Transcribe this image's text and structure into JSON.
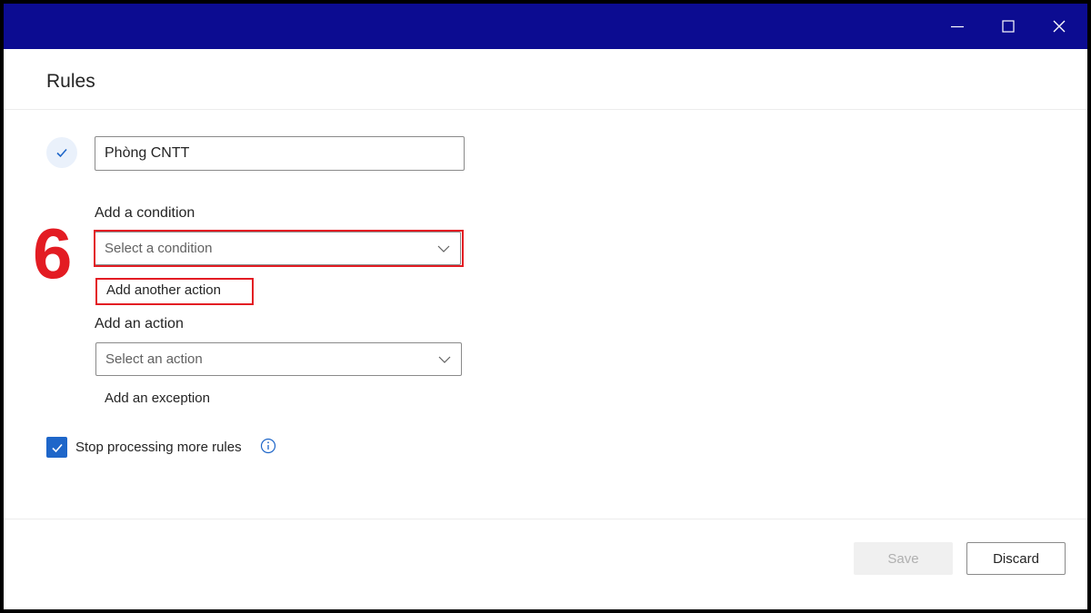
{
  "window": {
    "title_bar_color": "#0c0c91",
    "controls": [
      "minimize-icon",
      "maximize-icon",
      "close-icon"
    ]
  },
  "header": {
    "title": "Rules"
  },
  "rule": {
    "name_value": "Phòng CNTT",
    "condition": {
      "label": "Add a condition",
      "placeholder": "Select a condition"
    },
    "add_another_action": "Add another action",
    "action": {
      "label": "Add an action",
      "placeholder": "Select an action"
    },
    "add_exception": "Add an exception",
    "stop_processing": {
      "label": "Stop processing more rules",
      "checked": true
    }
  },
  "annotation": {
    "step_number": "6",
    "color": "#e31c23"
  },
  "footer": {
    "save_label": "Save",
    "save_enabled": false,
    "discard_label": "Discard"
  },
  "colors": {
    "accent": "#1e66c9",
    "highlight": "#e31c23"
  }
}
